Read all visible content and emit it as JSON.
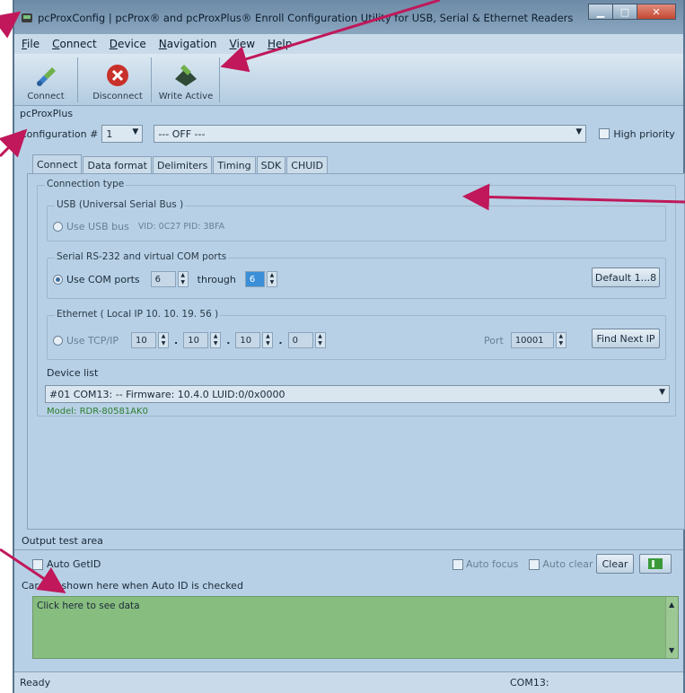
{
  "window": {
    "title": "pcProxConfig | pcProx® and pcProxPlus® Enroll Configuration Utility for USB, Serial & Ethernet Readers"
  },
  "menu": [
    "File",
    "Connect",
    "Device",
    "Navigation",
    "View",
    "Help"
  ],
  "toolbar": {
    "connect": "Connect",
    "disconnect": "Disconnect",
    "write_active": "Write Active"
  },
  "group_title": "pcProxPlus",
  "config": {
    "label": "Configuration #",
    "number": "1",
    "selection": "--- OFF ---",
    "high_priority": "High priority"
  },
  "tabs": [
    "Connect",
    "Data format",
    "Delimiters",
    "Timing",
    "SDK",
    "CHUID"
  ],
  "connection": {
    "title": "Connection type",
    "usb": {
      "legend": "USB (Universal Serial Bus )",
      "option": "Use USB bus",
      "ids": "VID: 0C27 PID: 3BFA"
    },
    "serial": {
      "legend": "Serial RS-232 and virtual COM ports",
      "option": "Use COM ports",
      "from": "6",
      "through_label": "through",
      "to": "6",
      "default_button": "Default 1...8"
    },
    "ethernet": {
      "legend": "Ethernet ( Local IP 10. 10. 19. 56 )",
      "option": "Use TCP/IP",
      "ip1": "10",
      "ip2": "10",
      "ip3": "10",
      "ip4": "0",
      "port_label": "Port",
      "port": "10001",
      "find_button": "Find Next IP"
    },
    "device_list": {
      "label": "Device list",
      "selected": "#01 COM13: -- Firmware: 10.4.0 LUID:0/0x0000",
      "model": "Model: RDR-80581AK0"
    }
  },
  "output": {
    "title": "Output test area",
    "auto_getid": "Auto GetID",
    "auto_focus": "Auto focus",
    "auto_clear": "Auto clear",
    "clear_button": "Clear",
    "card_id_hint": "Card ID shown here when Auto ID is checked",
    "data_hint": "Click here to see data"
  },
  "status": {
    "left": "Ready",
    "port": "COM13:"
  },
  "colors": {
    "annotation_arrow": "#c0185a",
    "output_area": "#87bd7e",
    "model_text": "#2d7d2d"
  }
}
